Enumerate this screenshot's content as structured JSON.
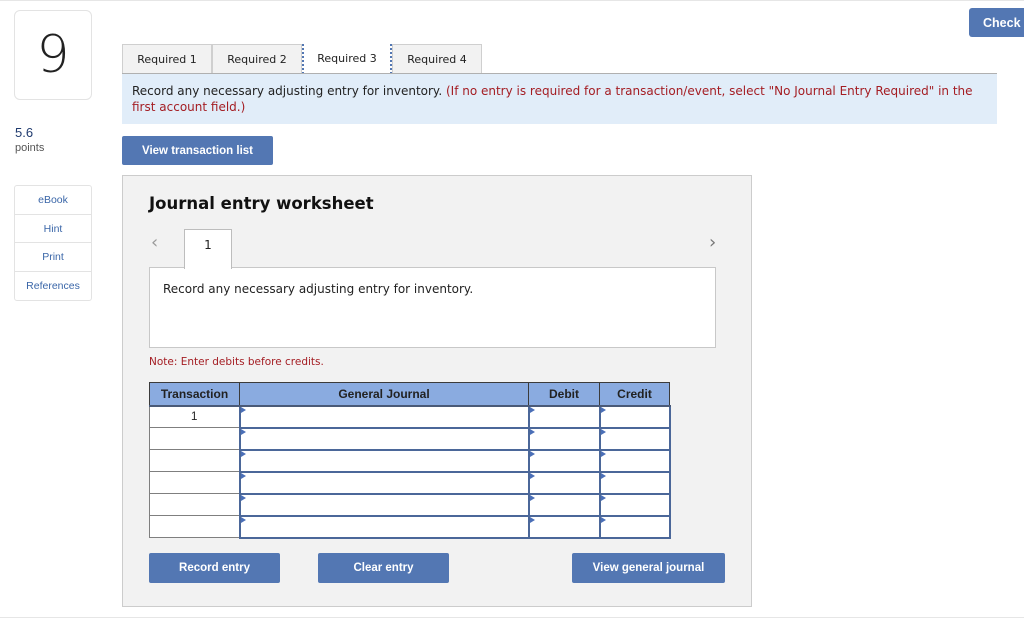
{
  "question": {
    "number": "9",
    "points_value": "5.6",
    "points_label": "points"
  },
  "sidebar": {
    "links": [
      {
        "label": "eBook"
      },
      {
        "label": "Hint"
      },
      {
        "label": "Print"
      },
      {
        "label": "References"
      }
    ]
  },
  "header": {
    "check_label": "Check"
  },
  "tabs": [
    {
      "label": "Required 1",
      "active": false
    },
    {
      "label": "Required 2",
      "active": false
    },
    {
      "label": "Required 3",
      "active": true
    },
    {
      "label": "Required 4",
      "active": false
    }
  ],
  "instructions": {
    "main": "Record any necessary adjusting entry for inventory.",
    "note": "(If no entry is required for a transaction/event, select \"No Journal Entry Required\" in the first account field.)"
  },
  "view_transaction_list_label": "View transaction list",
  "worksheet": {
    "title": "Journal entry worksheet",
    "prev_icon": "chevron-left",
    "next_icon": "chevron-right",
    "current_tab": "1",
    "description": "Record any necessary adjusting entry for inventory.",
    "note": "Note: Enter debits before credits.",
    "table": {
      "headers": [
        "Transaction",
        "General Journal",
        "Debit",
        "Credit"
      ],
      "rows": [
        {
          "transaction": "1",
          "account": "",
          "debit": "",
          "credit": ""
        },
        {
          "transaction": "",
          "account": "",
          "debit": "",
          "credit": ""
        },
        {
          "transaction": "",
          "account": "",
          "debit": "",
          "credit": ""
        },
        {
          "transaction": "",
          "account": "",
          "debit": "",
          "credit": ""
        },
        {
          "transaction": "",
          "account": "",
          "debit": "",
          "credit": ""
        },
        {
          "transaction": "",
          "account": "",
          "debit": "",
          "credit": ""
        }
      ]
    },
    "buttons": {
      "record": "Record entry",
      "clear": "Clear entry",
      "view_journal": "View general journal"
    }
  },
  "colors": {
    "accent": "#5377b3",
    "table_header": "#8aabe0",
    "alert_red": "#a41d23",
    "instruction_bg": "#e1edf9"
  }
}
